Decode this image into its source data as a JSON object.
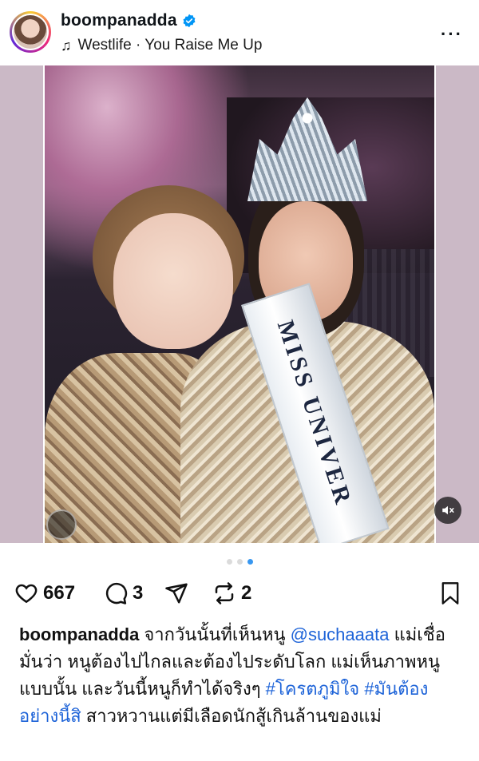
{
  "post": {
    "username": "boompanadda",
    "verified": true,
    "music": "Westlife · You Raise Me Up",
    "more_label": "···",
    "sash_text": "MISS UNIVER",
    "pagination": {
      "count": 3,
      "active": 3
    },
    "likes": "667",
    "comments": "3",
    "reposts": "2",
    "caption": {
      "username": "boompanadda",
      "text_1": "จากวันนั้นที่เห็นหนู",
      "mention": "@suchaaata",
      "text_2": "แม่เชื่อมั่นว่า หนูต้องไปไกลและต้องไประดับโลก แม่เห็นภาพหนูแบบนั้น และวันนี้หนูก็ทำได้จริงๆ",
      "hashtag_1": "#โครตภูมิใจ",
      "hashtag_2": "#มันต้องอย่างนี้สิ",
      "text_3": "สาวหวานแต่มีเลือดนักสู้เกินล้านของแม่"
    }
  },
  "icons": {
    "verified": "verified-badge-icon",
    "music": "music-note-icon",
    "more": "more-icon",
    "like": "heart-icon",
    "comment": "comment-icon",
    "share": "share-icon",
    "repost": "repost-icon",
    "save": "bookmark-icon",
    "mute": "muted-speaker-icon"
  },
  "colors": {
    "link": "#1d63d8",
    "verified": "#0095f6",
    "dot_active": "#3897f0",
    "dot_inactive": "#dbdbdb"
  }
}
